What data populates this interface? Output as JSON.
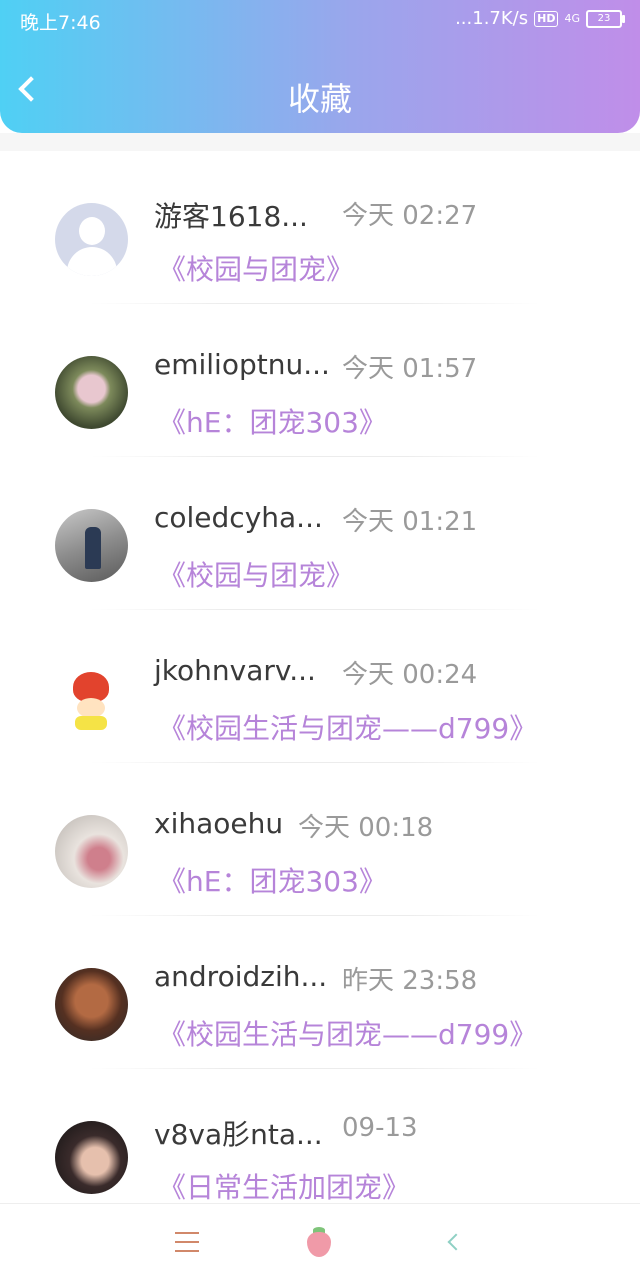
{
  "status_bar": {
    "time": "晚上7:46",
    "network_speed": "...1.7K/s",
    "hd": "HD",
    "signal": "4G",
    "battery": "23"
  },
  "header": {
    "title": "收藏",
    "back_icon": "chevron-left-icon"
  },
  "colors": {
    "header_gradient": [
      "#4fd0f4",
      "#9aa6ec",
      "#c08ee9"
    ],
    "book_title": "#b684d9",
    "time_text": "#9a9a9a"
  },
  "favorites": [
    {
      "user": "游客1618...",
      "time": "今天 02:27",
      "book": "《校园与团宠》",
      "avatar": "default-avatar"
    },
    {
      "user": "emilioptnu...",
      "time": "今天 01:57",
      "book": "《hE：团宠303》",
      "avatar": "cactus-avatar"
    },
    {
      "user": "coledcyha...",
      "time": "今天 01:21",
      "book": "《校园与团宠》",
      "avatar": "street-avatar"
    },
    {
      "user": "jkohnvarv...",
      "time": "今天 00:24",
      "book": "《校园生活与团宠——d799》",
      "avatar": "strawberry-avatar"
    },
    {
      "user": "xihaoehu",
      "time": "今天 00:18",
      "book": "《hE：团宠303》",
      "avatar": "flower-avatar"
    },
    {
      "user": "androidzih...",
      "time": "昨天 23:58",
      "book": "《校园生活与团宠——d799》",
      "avatar": "muscle-avatar"
    },
    {
      "user": "v8va肜nta...",
      "time": "09-13",
      "book": "《日常生活加团宠》",
      "avatar": "girl-avatar"
    }
  ],
  "bottom_bar": {
    "items": [
      "menu-icon",
      "strawberry-icon",
      "back-icon"
    ]
  }
}
